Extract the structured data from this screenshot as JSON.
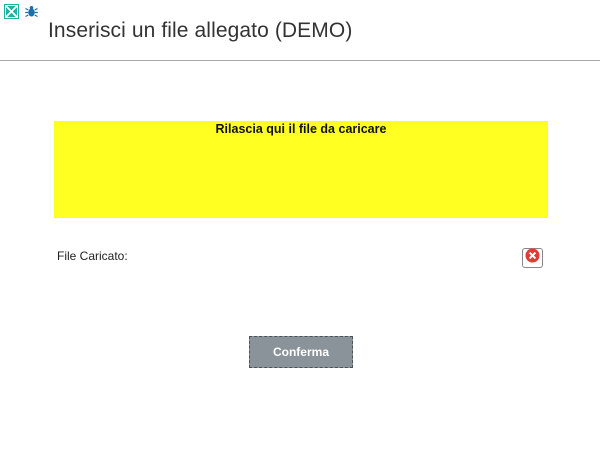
{
  "window": {
    "title": "Inserisci un file allegato (DEMO)",
    "icons": [
      "close-box-icon",
      "bug-icon"
    ]
  },
  "drop_zone": {
    "label": "Rilascia qui il file da caricare",
    "color": "#ffff22"
  },
  "uploaded_file": {
    "label": "File Caricato:",
    "value": "",
    "remove_icon": "remove-x-icon"
  },
  "actions": {
    "confirm_label": "Conferma"
  }
}
